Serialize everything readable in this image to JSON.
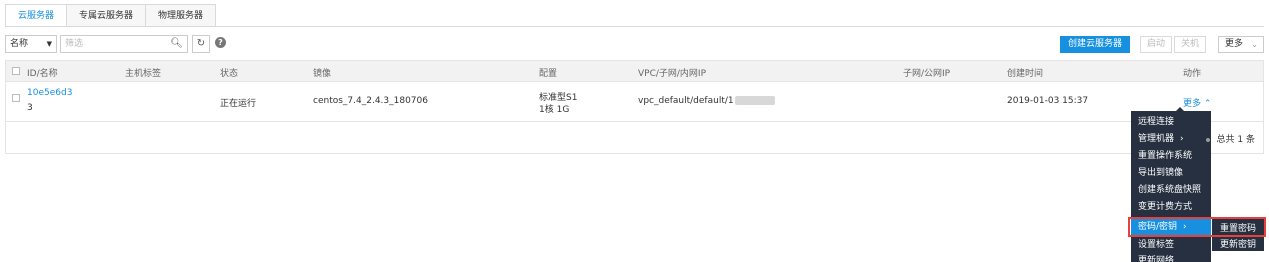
{
  "tabs": [
    {
      "label": "云服务器",
      "active": true
    },
    {
      "label": "专属云服务器",
      "active": false
    },
    {
      "label": "物理服务器",
      "active": false
    }
  ],
  "toolbar": {
    "filter_select": "名称",
    "search_placeholder": "筛选",
    "create_button": "创建云服务器",
    "start_button": "启动",
    "stop_button": "关机",
    "more_button": "更多"
  },
  "table": {
    "headers": [
      "ID/名称",
      "主机标签",
      "状态",
      "镜像",
      "配置",
      "VPC/子网/内网IP",
      "子网/公网IP",
      "创建时间",
      "动作"
    ],
    "rows": [
      {
        "id": "10e5e6d3",
        "name": "3",
        "tag": "",
        "status": "正在运行",
        "image": "centos_7.4_2.4.3_180706",
        "config_line1": "标准型S1",
        "config_line2": "1核 1G",
        "vpc": "vpc_default/default/1",
        "public_ip": "",
        "created": "2019-01-03 15:37",
        "action": "更多"
      }
    ],
    "total": "总共 1 条"
  },
  "menu": {
    "items": [
      "远程连接",
      "管理机器",
      "重置操作系统",
      "导出到镜像",
      "创建系统盘快照",
      "变更计费方式",
      "密码/密钥",
      "设置标签",
      "更新网络"
    ],
    "active_index": 6,
    "submenu": [
      "重置密码",
      "更新密钥"
    ]
  },
  "colors": {
    "accent": "#1890e0",
    "menu_bg": "#263040",
    "highlight": "#e8403a"
  }
}
